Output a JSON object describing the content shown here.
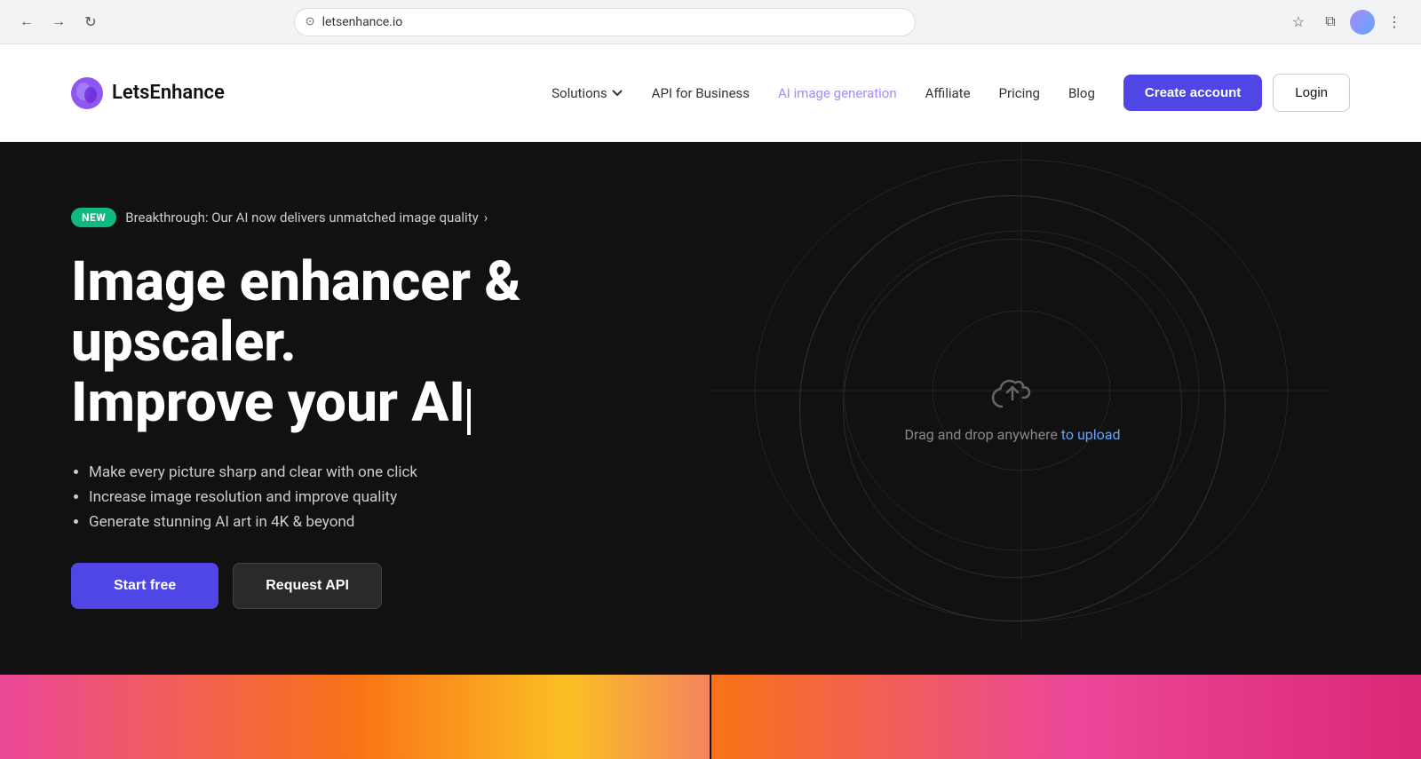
{
  "browser": {
    "url": "letsenhance.io",
    "favicon": "🌐"
  },
  "navbar": {
    "logo_text": "LetsEnhance",
    "nav_links": [
      {
        "label": "Solutions",
        "has_dropdown": true,
        "active": false
      },
      {
        "label": "API for Business",
        "has_dropdown": false,
        "active": false
      },
      {
        "label": "AI image generation",
        "has_dropdown": false,
        "active": true
      },
      {
        "label": "Affiliate",
        "has_dropdown": false,
        "active": false
      },
      {
        "label": "Pricing",
        "has_dropdown": false,
        "active": false
      },
      {
        "label": "Blog",
        "has_dropdown": false,
        "active": false
      }
    ],
    "create_account": "Create account",
    "login": "Login"
  },
  "hero": {
    "badge_new": "NEW",
    "badge_text": "Breakthrough: Our AI now delivers unmatched image quality",
    "title_line1": "Image enhancer & upscaler.",
    "title_line2": "Improve your AI",
    "bullets": [
      "Make every picture sharp and clear with one click",
      "Increase image resolution and improve quality",
      "Generate stunning AI art in 4K & beyond"
    ],
    "btn_start": "Start free",
    "btn_api": "Request API",
    "upload_text": "Drag and drop anywhere ",
    "upload_link": "to upload"
  }
}
